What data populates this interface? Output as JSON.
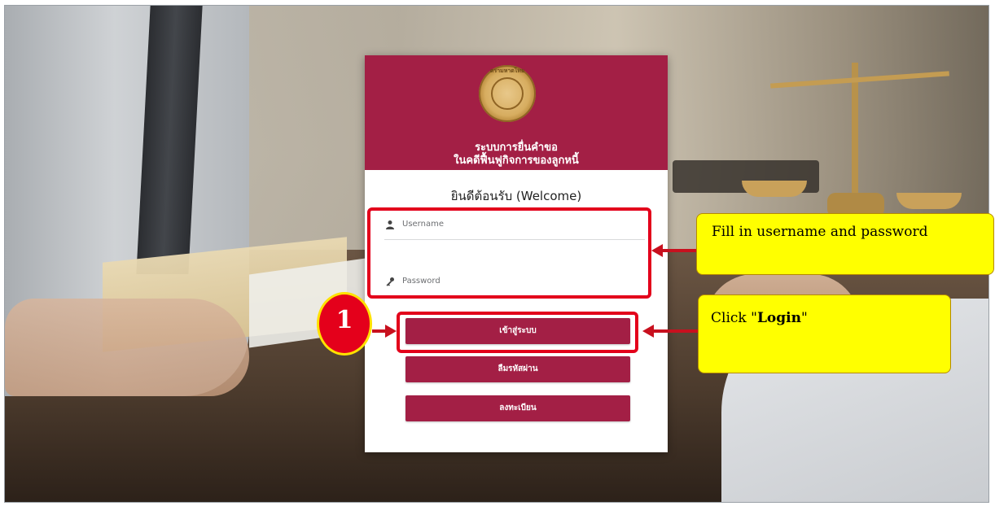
{
  "system": {
    "seal_text": "ตรามหาดไทย",
    "title_line1": "ระบบการยื่นคำขอ",
    "title_line2": "ในคดีฟื้นฟูกิจการของลูกหนี้",
    "welcome": "ยินดีต้อนรับ (Welcome)"
  },
  "form": {
    "username_placeholder": "Username",
    "password_placeholder": "Password",
    "user_icon": "user-icon",
    "password_icon": "key-icon"
  },
  "buttons": {
    "login": "เข้าสู่ระบบ",
    "forgot_password": "ลืมรหัสผ่าน",
    "register": "ลงทะเบียน"
  },
  "annotations": {
    "step_number": "1",
    "callout_fields": "Fill in username and password",
    "callout_login_prefix": "Click \"",
    "callout_login_bold": "Login",
    "callout_login_suffix": "\""
  },
  "colors": {
    "brand": "#a31f45",
    "highlight": "#e3001b",
    "callout": "#ffff00"
  }
}
